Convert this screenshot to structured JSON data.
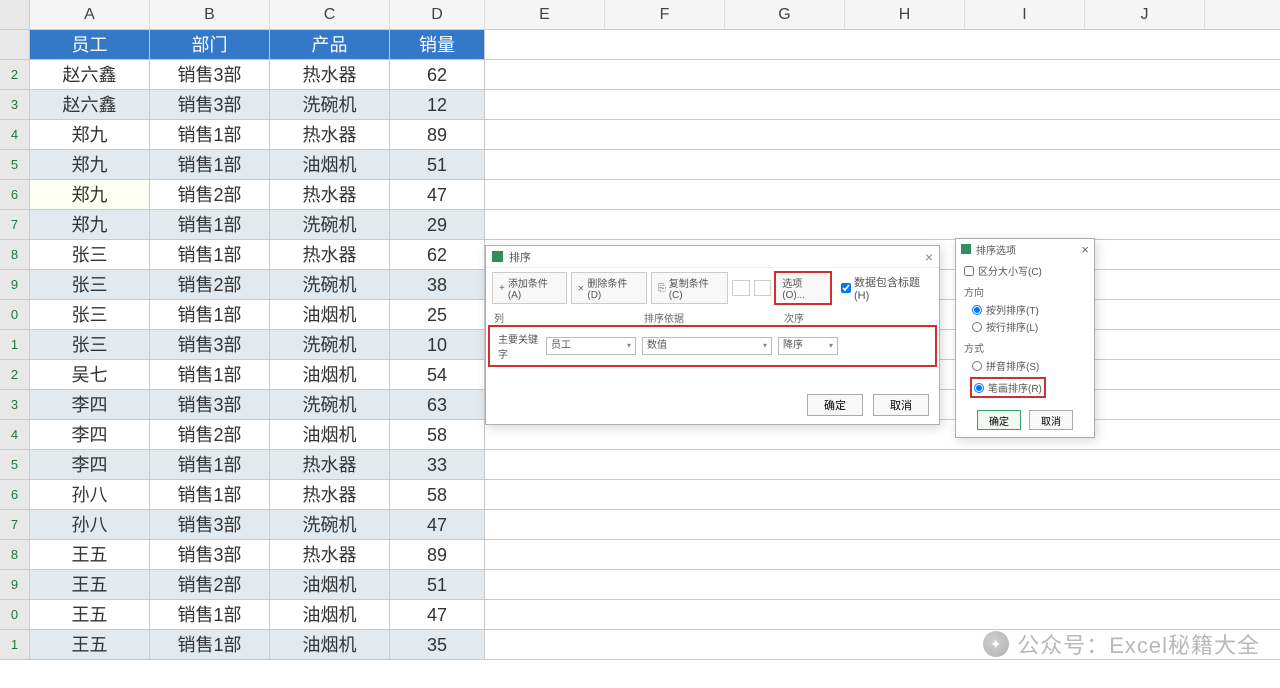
{
  "columns": [
    "A",
    "B",
    "C",
    "D",
    "E",
    "F",
    "G",
    "H",
    "I",
    "J"
  ],
  "col_widths": {
    "A": 120,
    "B": 120,
    "C": 120,
    "D": 95,
    "rest": 120
  },
  "table": {
    "headers": [
      "员工",
      "部门",
      "产品",
      "销量"
    ],
    "rows": [
      {
        "emp": "赵六鑫",
        "dept": "销售3部",
        "prod": "热水器",
        "qty": "62"
      },
      {
        "emp": "赵六鑫",
        "dept": "销售3部",
        "prod": "洗碗机",
        "qty": "12"
      },
      {
        "emp": "郑九",
        "dept": "销售1部",
        "prod": "热水器",
        "qty": "89"
      },
      {
        "emp": "郑九",
        "dept": "销售1部",
        "prod": "油烟机",
        "qty": "51"
      },
      {
        "emp": "郑九",
        "dept": "销售2部",
        "prod": "热水器",
        "qty": "47",
        "highlight_emp": true
      },
      {
        "emp": "郑九",
        "dept": "销售1部",
        "prod": "洗碗机",
        "qty": "29"
      },
      {
        "emp": "张三",
        "dept": "销售1部",
        "prod": "热水器",
        "qty": "62"
      },
      {
        "emp": "张三",
        "dept": "销售2部",
        "prod": "洗碗机",
        "qty": "38"
      },
      {
        "emp": "张三",
        "dept": "销售1部",
        "prod": "油烟机",
        "qty": "25"
      },
      {
        "emp": "张三",
        "dept": "销售3部",
        "prod": "洗碗机",
        "qty": "10"
      },
      {
        "emp": "吴七",
        "dept": "销售1部",
        "prod": "油烟机",
        "qty": "54"
      },
      {
        "emp": "李四",
        "dept": "销售3部",
        "prod": "洗碗机",
        "qty": "63"
      },
      {
        "emp": "李四",
        "dept": "销售2部",
        "prod": "油烟机",
        "qty": "58"
      },
      {
        "emp": "李四",
        "dept": "销售1部",
        "prod": "热水器",
        "qty": "33"
      },
      {
        "emp": "孙八",
        "dept": "销售1部",
        "prod": "热水器",
        "qty": "58"
      },
      {
        "emp": "孙八",
        "dept": "销售3部",
        "prod": "洗碗机",
        "qty": "47"
      },
      {
        "emp": "王五",
        "dept": "销售3部",
        "prod": "热水器",
        "qty": "89"
      },
      {
        "emp": "王五",
        "dept": "销售2部",
        "prod": "油烟机",
        "qty": "51"
      },
      {
        "emp": "王五",
        "dept": "销售1部",
        "prod": "油烟机",
        "qty": "47"
      },
      {
        "emp": "王五",
        "dept": "销售1部",
        "prod": "油烟机",
        "qty": "35"
      }
    ]
  },
  "sort_dialog": {
    "title": "排序",
    "add_btn": "添加条件(A)",
    "del_btn": "删除条件(D)",
    "copy_btn": "复制条件(C)",
    "options_btn": "选项(O)...",
    "header_chk": "数据包含标题(H)",
    "col_hdr_col": "列",
    "col_hdr_sorton": "排序依据",
    "col_hdr_order": "次序",
    "primary_lbl": "主要关键字",
    "primary_col": "员工",
    "primary_sorton": "数值",
    "primary_order": "降序",
    "ok": "确定",
    "cancel": "取消"
  },
  "options_dialog": {
    "title": "排序选项",
    "case_chk": "区分大小写(C)",
    "orient_title": "方向",
    "orient_topbot": "按列排序(T)",
    "orient_leftright": "按行排序(L)",
    "method_title": "方式",
    "method_pinyin": "拼音排序(S)",
    "method_stroke": "笔画排序(R)",
    "ok": "确定",
    "cancel": "取消"
  },
  "watermark": {
    "text": "公众号：Excel秘籍大全"
  }
}
